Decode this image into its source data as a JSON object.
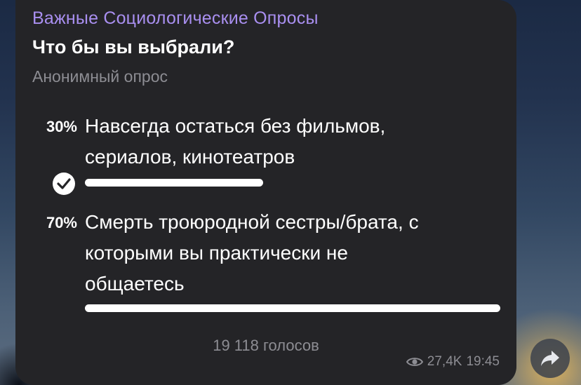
{
  "poll": {
    "channel": "Важные Социологические Опросы",
    "question": "Что бы вы выбрали?",
    "type": "Анонимный опрос",
    "options": [
      {
        "percent": "30%",
        "line1": "Навсегда остаться без фильмов,",
        "line2": "сериалов, кинотеатров",
        "line3": "",
        "share": 0.3,
        "selected": true
      },
      {
        "percent": "70%",
        "line1": "Смерть троюродной сестры/брата, с",
        "line2": "которыми вы практически не",
        "line3": "общаетесь",
        "share": 0.7,
        "selected": false
      }
    ],
    "votes": "19 118 голосов",
    "views": "27,4K",
    "time": "19:45"
  },
  "colors": {
    "bubble": "#242427",
    "channel": "#a98ff0",
    "muted": "#8d8d93",
    "text": "#ffffff"
  },
  "icons": {
    "check": "checkmark-icon",
    "views": "eye-icon",
    "share": "share-arrow-icon"
  }
}
